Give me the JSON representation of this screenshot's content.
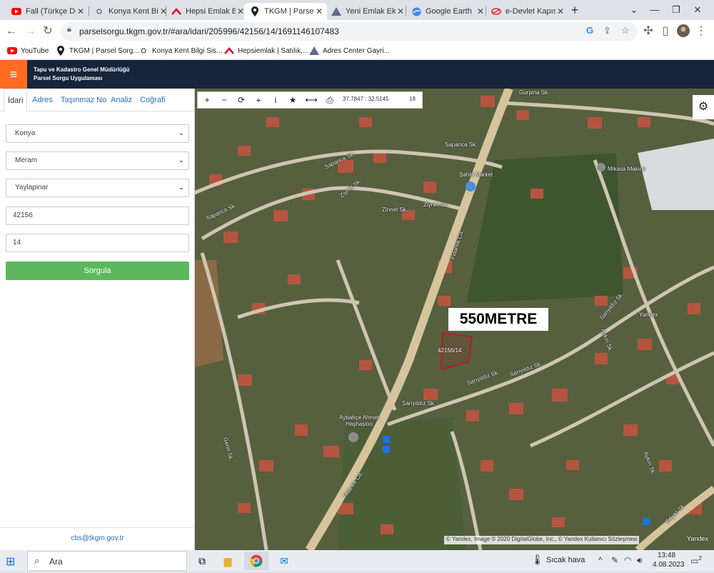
{
  "browser": {
    "tabs": [
      {
        "title": "Fall (Türkçe Dub",
        "icon": "youtube-icon",
        "color": "#ff0000"
      },
      {
        "title": "Konya Kent Bilgi",
        "icon": "gis-icon",
        "color": "#555555"
      },
      {
        "title": "Hepsi Emlak Bu",
        "icon": "hepsiemlak-icon",
        "color": "#e4002b"
      },
      {
        "title": "TKGM | Parsel S",
        "icon": "location-pin-icon",
        "color": "#202124"
      },
      {
        "title": "Yeni Emlak Ekle",
        "icon": "adres-icon",
        "color": "#5a6b8c"
      },
      {
        "title": "Google Earth",
        "icon": "google-earth-icon",
        "color": "#4285f4"
      },
      {
        "title": "e-Devlet Kapısı",
        "icon": "edevlet-icon",
        "color": "#d42027"
      }
    ],
    "new_tab": "+",
    "url": "parselsorgu.tkgm.gov.tr/#ara/idari/205996/42156/14/1691146107483",
    "bookmarks": [
      {
        "label": "YouTube",
        "icon": "youtube-icon"
      },
      {
        "label": "TKGM | Parsel Sorg...",
        "icon": "location-pin-icon"
      },
      {
        "label": "Konya Kent Bilgi Sis...",
        "icon": "gis-icon"
      },
      {
        "label": "Hepsiemlak | Satılık,...",
        "icon": "hepsiemlak-icon"
      },
      {
        "label": "Adres Center Gayri...",
        "icon": "adres-icon"
      }
    ]
  },
  "site": {
    "title_line1": "Tapu ve Kadastro Genel Müdürlüğü",
    "title_line2": "Parsel Sorgu Uygulaması",
    "accent": "#ff6b1f",
    "header_bg": "#16253b"
  },
  "panel": {
    "tabs": [
      "İdari",
      "Adres",
      "Taşınmaz No",
      "Analiz",
      "Coğrafi"
    ],
    "active_tab": "İdari",
    "province": "Konya",
    "district": "Meram",
    "neighborhood": "Yaylapinar",
    "block_no": "42156",
    "parcel_no": "14",
    "submit": "Sorgula",
    "submit_color": "#5cb85c",
    "footer_email": "cbs@tkgm.gov.tr"
  },
  "map": {
    "coords": "37.7847 : 32.5145",
    "zoom": "18",
    "banner": "550METRE",
    "parcel_label": "42156/14",
    "labels": [
      "Gurpina Sk.",
      "Sapanca Sk.",
      "Sapanca Sk.",
      "Sapanca Sk.",
      "Ziynet Sk.",
      "Ziynet Sk.",
      "Zinnet Sk.",
      "Şahin Market",
      "Mikasa Makine",
      "Fidanlık Cd.",
      "Fidanlık Cd.",
      "Sarıyıldız Sk.",
      "Sarıyıldız Sk.",
      "Sarıyıldız Sk.",
      "Sarıyıldız Sk.",
      "Aybahçe Ahmet Haşhaşioo",
      "Aykırı Sk.",
      "Aykırı Sk.",
      "Gerin Sk.",
      "Eriyaz Sk.",
      "Yandex"
    ],
    "attribution": "© Yandex, Image © 2020 DigitalGlobe, Inc., © Yandex Kullanıcı Sözleşmesi",
    "yandex_logo": "Yandex"
  },
  "taskbar": {
    "search": "Ara",
    "weather": "Sıcak hava",
    "time": "13:48",
    "date": "4.08.2023",
    "notifications": "2"
  }
}
